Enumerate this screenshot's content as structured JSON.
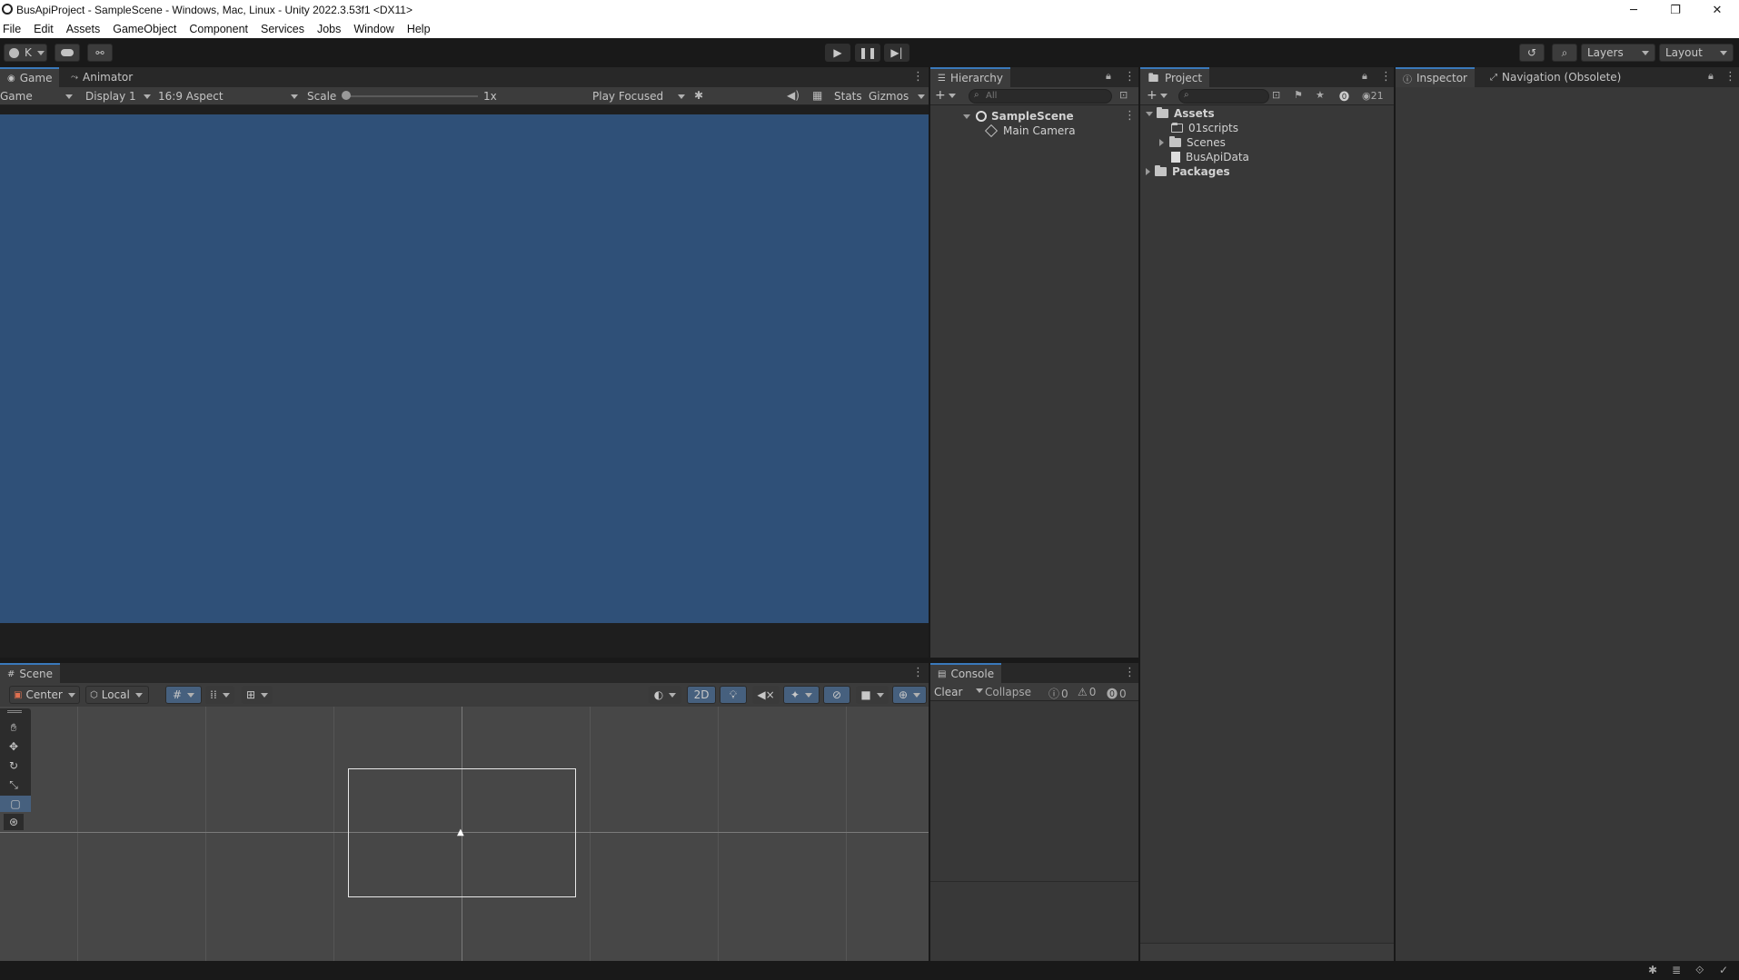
{
  "window": {
    "title": "BusApiProject - SampleScene - Windows, Mac, Linux - Unity 2022.3.53f1 <DX11>",
    "controls": {
      "minimize": "─",
      "maximize": "❐",
      "close": "✕"
    }
  },
  "menu": [
    "File",
    "Edit",
    "Assets",
    "GameObject",
    "Component",
    "Services",
    "Jobs",
    "Window",
    "Help"
  ],
  "toolbar": {
    "account": "K",
    "layers_label": "Layers",
    "layout_label": "Layout"
  },
  "game": {
    "tabs": [
      "Game",
      "Animator"
    ],
    "mode": "Game",
    "display": "Display 1",
    "aspect": "16:9 Aspect",
    "scale_label": "Scale",
    "scale_value": "1x",
    "play_mode": "Play Focused",
    "stats": "Stats",
    "gizmos": "Gizmos",
    "view_color": "#2f5078"
  },
  "hierarchy": {
    "tab": "Hierarchy",
    "search_placeholder": "All",
    "scene": "SampleScene",
    "items": [
      "Main Camera"
    ]
  },
  "project": {
    "tab": "Project",
    "count": "21",
    "assets": "Assets",
    "children": [
      "01scripts",
      "Scenes",
      "BusApiData"
    ],
    "packages": "Packages"
  },
  "inspector": {
    "tabs": [
      "Inspector",
      "Navigation (Obsolete)"
    ]
  },
  "scene": {
    "tab": "Scene",
    "pivot": "Center",
    "space": "Local",
    "mode_2d": "2D"
  },
  "console": {
    "tab": "Console",
    "clear": "Clear",
    "collapse": "Collapse",
    "counts": {
      "info": "0",
      "warn": "0",
      "error": "0"
    }
  }
}
